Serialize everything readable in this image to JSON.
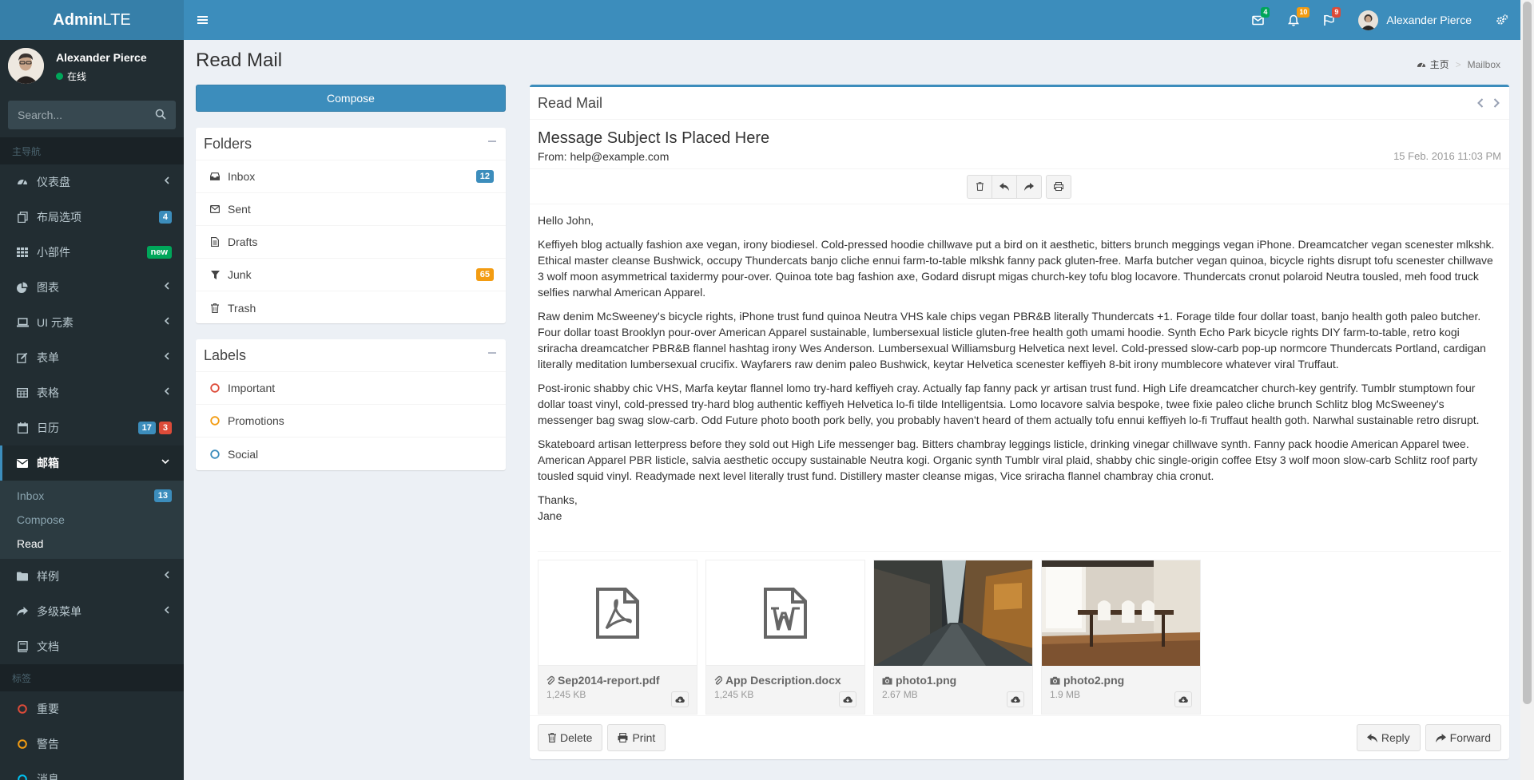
{
  "header": {
    "logo_bold": "Admin",
    "logo_light": "LTE",
    "mail_count": "4",
    "notif_count": "10",
    "task_count": "9",
    "user_name": "Alexander Pierce"
  },
  "sidebar": {
    "user_name": "Alexander Pierce",
    "user_status": "在线",
    "search_placeholder": "Search...",
    "main_header": "主导航",
    "items": [
      {
        "label": "仪表盘",
        "icon": "dashboard-icon"
      },
      {
        "label": "布局选项",
        "icon": "files-icon",
        "badge": "4"
      },
      {
        "label": "小部件",
        "icon": "th-icon",
        "badge": "new"
      },
      {
        "label": "图表",
        "icon": "pie-chart-icon"
      },
      {
        "label": "UI 元素",
        "icon": "laptop-icon"
      },
      {
        "label": "表单",
        "icon": "edit-icon"
      },
      {
        "label": "表格",
        "icon": "table-icon"
      },
      {
        "label": "日历",
        "icon": "calendar-icon",
        "badge1": "17",
        "badge2": "3"
      },
      {
        "label": "邮箱",
        "icon": "envelope-icon"
      },
      {
        "label": "样例",
        "icon": "folder-icon"
      },
      {
        "label": "多级菜单",
        "icon": "share-icon"
      },
      {
        "label": "文档",
        "icon": "book-icon"
      }
    ],
    "sub_items": [
      {
        "label": "Inbox",
        "badge": "13"
      },
      {
        "label": "Compose"
      },
      {
        "label": "Read"
      }
    ],
    "labels_header": "标签",
    "labels": [
      {
        "label": "重要",
        "color": "#dd4b39"
      },
      {
        "label": "警告",
        "color": "#f39c12"
      },
      {
        "label": "消息",
        "color": "#00c0ef"
      }
    ]
  },
  "page": {
    "title": "Read Mail",
    "breadcrumb_home": "主页",
    "breadcrumb_current": "Mailbox",
    "compose_label": "Compose"
  },
  "folders": {
    "title": "Folders",
    "items": [
      {
        "label": "Inbox",
        "badge": "12"
      },
      {
        "label": "Sent"
      },
      {
        "label": "Drafts"
      },
      {
        "label": "Junk",
        "badge": "65"
      },
      {
        "label": "Trash"
      }
    ]
  },
  "labels_box": {
    "title": "Labels",
    "items": [
      {
        "label": "Important",
        "color": "#dd4b39"
      },
      {
        "label": "Promotions",
        "color": "#f39c12"
      },
      {
        "label": "Social",
        "color": "#3c8dbc"
      }
    ]
  },
  "mail": {
    "box_title": "Read Mail",
    "subject": "Message Subject Is Placed Here",
    "from": "From: help@example.com",
    "date": "15 Feb. 2016 11:03 PM",
    "greeting": "Hello John,",
    "paragraphs": [
      "Keffiyeh blog actually fashion axe vegan, irony biodiesel. Cold-pressed hoodie chillwave put a bird on it aesthetic, bitters brunch meggings vegan iPhone. Dreamcatcher vegan scenester mlkshk. Ethical master cleanse Bushwick, occupy Thundercats banjo cliche ennui farm-to-table mlkshk fanny pack gluten-free. Marfa butcher vegan quinoa, bicycle rights disrupt tofu scenester chillwave 3 wolf moon asymmetrical taxidermy pour-over. Quinoa tote bag fashion axe, Godard disrupt migas church-key tofu blog locavore. Thundercats cronut polaroid Neutra tousled, meh food truck selfies narwhal American Apparel.",
      "Raw denim McSweeney's bicycle rights, iPhone trust fund quinoa Neutra VHS kale chips vegan PBR&B literally Thundercats +1. Forage tilde four dollar toast, banjo health goth paleo butcher. Four dollar toast Brooklyn pour-over American Apparel sustainable, lumbersexual listicle gluten-free health goth umami hoodie. Synth Echo Park bicycle rights DIY farm-to-table, retro kogi sriracha dreamcatcher PBR&B flannel hashtag irony Wes Anderson. Lumbersexual Williamsburg Helvetica next level. Cold-pressed slow-carb pop-up normcore Thundercats Portland, cardigan literally meditation lumbersexual crucifix. Wayfarers raw denim paleo Bushwick, keytar Helvetica scenester keffiyeh 8-bit irony mumblecore whatever viral Truffaut.",
      "Post-ironic shabby chic VHS, Marfa keytar flannel lomo try-hard keffiyeh cray. Actually fap fanny pack yr artisan trust fund. High Life dreamcatcher church-key gentrify. Tumblr stumptown four dollar toast vinyl, cold-pressed try-hard blog authentic keffiyeh Helvetica lo-fi tilde Intelligentsia. Lomo locavore salvia bespoke, twee fixie paleo cliche brunch Schlitz blog McSweeney's messenger bag swag slow-carb. Odd Future photo booth pork belly, you probably haven't heard of them actually tofu ennui keffiyeh lo-fi Truffaut health goth. Narwhal sustainable retro disrupt.",
      "Skateboard artisan letterpress before they sold out High Life messenger bag. Bitters chambray leggings listicle, drinking vinegar chillwave synth. Fanny pack hoodie American Apparel twee. American Apparel PBR listicle, salvia aesthetic occupy sustainable Neutra kogi. Organic synth Tumblr viral plaid, shabby chic single-origin coffee Etsy 3 wolf moon slow-carb Schlitz roof party tousled squid vinyl. Readymade next level literally trust fund. Distillery master cleanse migas, Vice sriracha flannel chambray chia cronut."
    ],
    "signoff1": "Thanks,",
    "signoff2": "Jane",
    "attachments": [
      {
        "name": "Sep2014-report.pdf",
        "size": "1,245 KB",
        "type": "pdf"
      },
      {
        "name": "App Description.docx",
        "size": "1,245 KB",
        "type": "doc"
      },
      {
        "name": "photo1.png",
        "size": "2.67 MB",
        "type": "img"
      },
      {
        "name": "photo2.png",
        "size": "1.9 MB",
        "type": "img"
      }
    ],
    "delete_label": "Delete",
    "print_label": "Print",
    "reply_label": "Reply",
    "forward_label": "Forward"
  }
}
